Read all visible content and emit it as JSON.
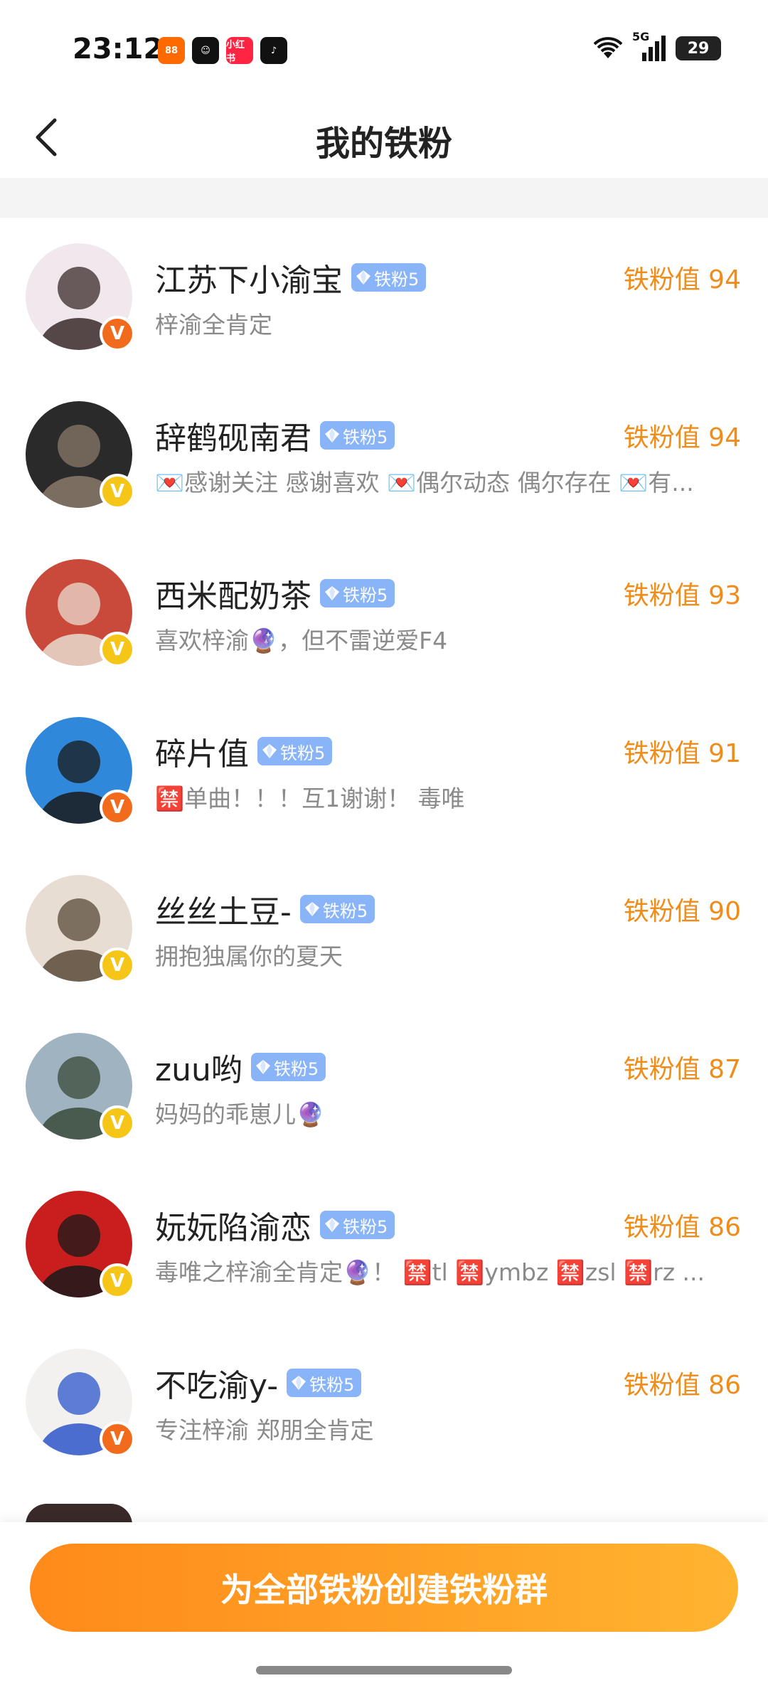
{
  "status_bar": {
    "time": "23:12",
    "battery": "29",
    "network": "5G",
    "apps": [
      {
        "icon": "app-icon-shopping",
        "label": "88",
        "color": "#ff6a00"
      },
      {
        "icon": "app-icon-smile",
        "label": "☺",
        "color": "#111111"
      },
      {
        "icon": "app-icon-xiaohongshu",
        "label": "小红书",
        "color": "#ff2442"
      },
      {
        "icon": "app-icon-tiktok",
        "label": "♪",
        "color": "#111111"
      }
    ]
  },
  "header": {
    "title": "我的铁粉",
    "back_icon": "chevron-left-icon"
  },
  "fans": [
    {
      "name": "江苏下小渝宝",
      "level": "铁粉5",
      "score": "铁粉值 94",
      "bio": "梓渝全肯定",
      "badge_color": "#f26b1d",
      "avatar_colors": [
        "#f1e8ee",
        "#3a2a2a"
      ]
    },
    {
      "name": "辞鹤砚南君",
      "level": "铁粉5",
      "score": "铁粉值 94",
      "bio": "💌感谢关注 感谢喜欢 💌偶尔动态 偶尔存在 💌有...",
      "badge_color": "#f5c518",
      "avatar_colors": [
        "#2a2a2a",
        "#8a7a6a"
      ]
    },
    {
      "name": "西米配奶茶",
      "level": "铁粉5",
      "score": "铁粉值 93",
      "bio": "喜欢梓渝🔮，但不雷逆爱F4",
      "badge_color": "#f5c518",
      "avatar_colors": [
        "#c94a3a",
        "#e9dccf"
      ]
    },
    {
      "name": "碎片值",
      "level": "铁粉5",
      "score": "铁粉值 91",
      "bio": "🈲单曲！！！互1谢谢！ 毒唯",
      "badge_color": "#f26b1d",
      "avatar_colors": [
        "#2f88d9",
        "#1a1a1a"
      ]
    },
    {
      "name": "丝丝土豆-",
      "level": "铁粉5",
      "score": "铁粉值 90",
      "bio": "拥抱独属你的夏天",
      "badge_color": "#f5c518",
      "avatar_colors": [
        "#e8ddd2",
        "#5a4a3a"
      ]
    },
    {
      "name": "zuu哟",
      "level": "铁粉5",
      "score": "铁粉值 87",
      "bio": "妈妈的乖崽儿🔮",
      "badge_color": "#f5c518",
      "avatar_colors": [
        "#9fb3c0",
        "#3a4a3a"
      ]
    },
    {
      "name": "妧妧陷渝恋",
      "level": "铁粉5",
      "score": "铁粉值 86",
      "bio": "毒唯之梓渝全肯定🔮！ 🈲tl 🈲ymbz 🈲zsl 🈲rz ...",
      "badge_color": "#f5c518",
      "avatar_colors": [
        "#c81e1e",
        "#1a1a1a"
      ]
    },
    {
      "name": "不吃渝y-",
      "level": "铁粉5",
      "score": "铁粉值 86",
      "bio": "专注梓渝 郑朋全肯定",
      "badge_color": "#f26b1d",
      "avatar_colors": [
        "#f3f0f0",
        "#2b56c9"
      ]
    }
  ],
  "footer": {
    "create_group_label": "为全部铁粉创建铁粉群"
  }
}
